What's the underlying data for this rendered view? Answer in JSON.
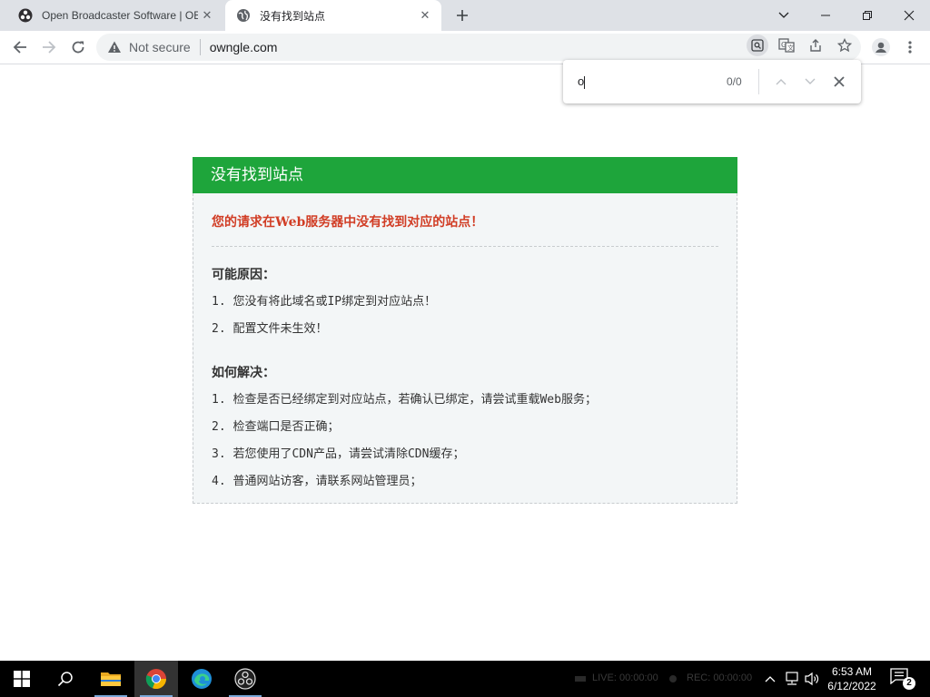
{
  "browser": {
    "tabs": [
      {
        "title": "Open Broadcaster Software | OBS",
        "active": false
      },
      {
        "title": "没有找到站点",
        "active": true
      }
    ],
    "security_label": "Not secure",
    "url": "owngle.com"
  },
  "find_bar": {
    "query": "o",
    "match_count": "0/0"
  },
  "page": {
    "header": "没有找到站点",
    "alert": "您的请求在Web服务器中没有找到对应的站点！",
    "causes_title": "可能原因：",
    "causes": [
      "1. 您没有将此域名或IP绑定到对应站点！",
      "2. 配置文件未生效！"
    ],
    "solutions_title": "如何解决：",
    "solutions": [
      "1. 检查是否已经绑定到对应站点，若确认已绑定，请尝试重载Web服务；",
      "2. 检查端口是否正确；",
      "3. 若您使用了CDN产品，请尝试清除CDN缓存；",
      "4. 普通网站访客，请联系网站管理员；"
    ]
  },
  "taskbar": {
    "obs_live": "LIVE: 00:00:00",
    "obs_rec": "REC: 00:00:00",
    "time": "6:53 AM",
    "date": "6/12/2022",
    "notification_count": "2"
  },
  "colors": {
    "header_green": "#1ea53b",
    "alert_red": "#d13d25",
    "body_bg": "#f3f6f7"
  }
}
